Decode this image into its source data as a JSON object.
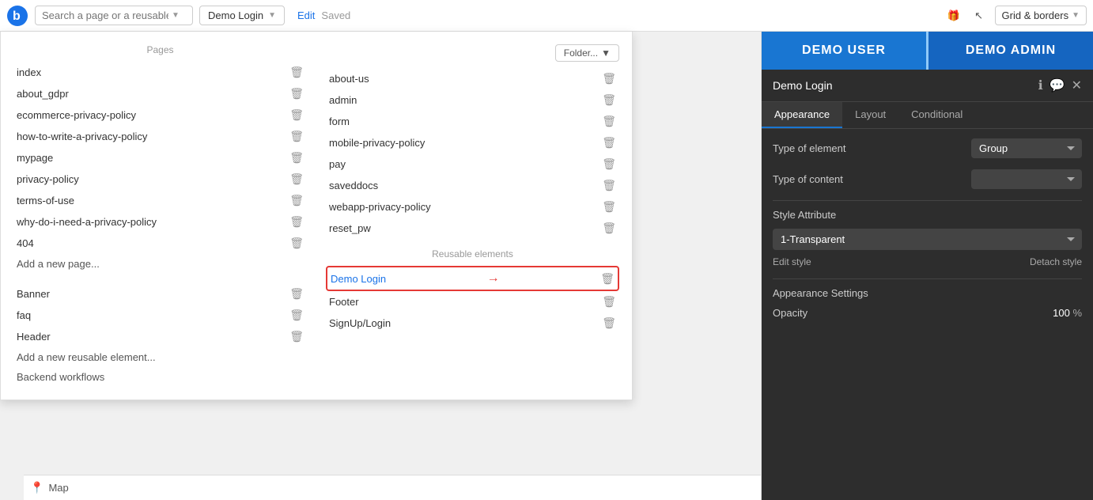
{
  "topbar": {
    "search_placeholder": "Search a page or a reusable...",
    "page_name": "Demo Login",
    "edit_label": "Edit",
    "saved_label": "Saved",
    "grid_label": "Grid & borders",
    "logo_text": "b"
  },
  "dropdown": {
    "pages_label": "Pages",
    "folder_label": "Folder...",
    "reusable_label": "Reusable elements",
    "left_pages": [
      "index",
      "about_gdpr",
      "ecommerce-privacy-policy",
      "how-to-write-a-privacy-policy",
      "mypage",
      "privacy-policy",
      "terms-of-use",
      "why-do-i-need-a-privacy-policy",
      "404"
    ],
    "right_pages": [
      "about-us",
      "admin",
      "form",
      "mobile-privacy-policy",
      "pay",
      "saveddocs",
      "webapp-privacy-policy",
      "reset_pw"
    ],
    "add_page_label": "Add a new page...",
    "left_reusable": [
      "Banner",
      "faq",
      "Header"
    ],
    "right_reusable": [
      "Demo Login",
      "Footer",
      "SignUp/Login"
    ],
    "add_reusable_label": "Add a new reusable element...",
    "backend_label": "Backend workflows",
    "highlighted_item": "Demo Login",
    "map_label": "Map"
  },
  "right_panel": {
    "demo_user_label": "DEMO USER",
    "demo_admin_label": "DEMO ADMIN",
    "title": "Demo Login",
    "tabs": [
      "Appearance",
      "Layout",
      "Conditional"
    ],
    "active_tab": "Appearance",
    "type_of_element_label": "Type of element",
    "type_of_element_value": "Group",
    "type_of_content_label": "Type of content",
    "type_of_content_value": "",
    "style_attribute_label": "Style Attribute",
    "style_value": "1-Transparent",
    "edit_style_label": "Edit style",
    "detach_style_label": "Detach style",
    "appearance_settings_label": "Appearance Settings",
    "opacity_label": "Opacity",
    "opacity_value": "100",
    "opacity_unit": "%",
    "info_icon": "ℹ",
    "comment_icon": "💬",
    "close_icon": "✕"
  }
}
